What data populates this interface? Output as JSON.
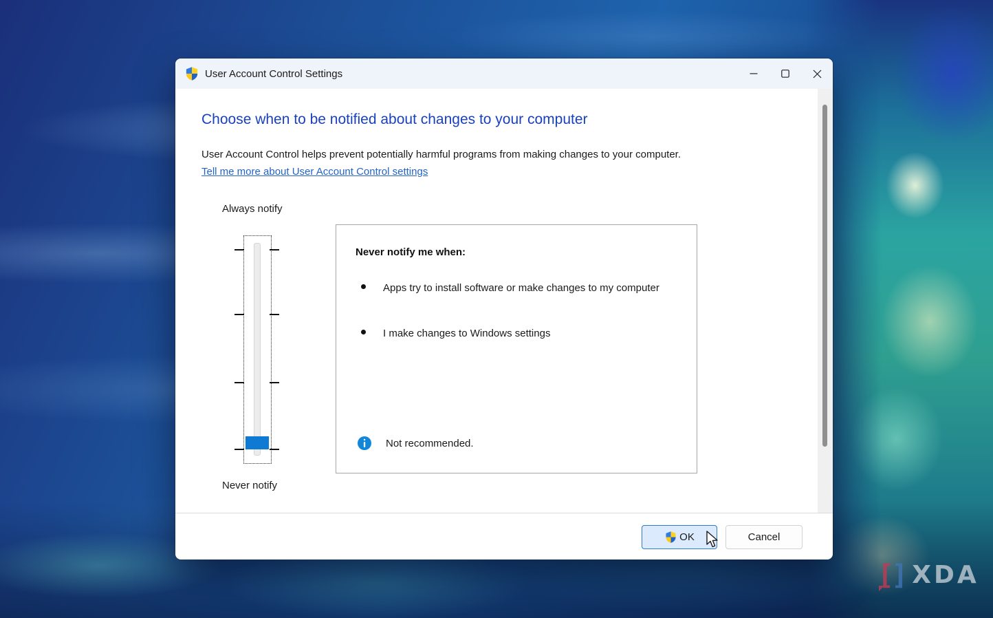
{
  "window": {
    "title": "User Account Control Settings",
    "icon": "uac-shield-icon",
    "controls": {
      "minimize": "minimize",
      "maximize": "maximize",
      "close": "close"
    }
  },
  "content": {
    "heading": "Choose when to be notified about changes to your computer",
    "description": "User Account Control helps prevent potentially harmful programs from making changes to your computer.",
    "link_text": "Tell me more about User Account Control settings",
    "slider": {
      "top_label": "Always notify",
      "bottom_label": "Never notify",
      "selected_level": "Never notify",
      "tick_count": 4
    },
    "panel": {
      "heading": "Never notify me when:",
      "bullets": [
        "Apps try to install software or make changes to my computer",
        "I make changes to Windows settings"
      ],
      "note": "Not recommended.",
      "note_icon": "info-icon"
    }
  },
  "footer": {
    "ok_label": "OK",
    "cancel_label": "Cancel"
  },
  "watermark": {
    "bracket_left": "[",
    "bracket_right": "]",
    "text": "XDA"
  },
  "colors": {
    "heading_blue": "#1a41bd",
    "link_blue": "#2563c4",
    "slider_thumb_blue": "#0e7ad3",
    "ok_button_bg": "#dbeafc",
    "ok_button_border": "#2d7cc9",
    "info_icon_blue": "#1287d8",
    "titlebar_bg": "#eff3fa"
  }
}
